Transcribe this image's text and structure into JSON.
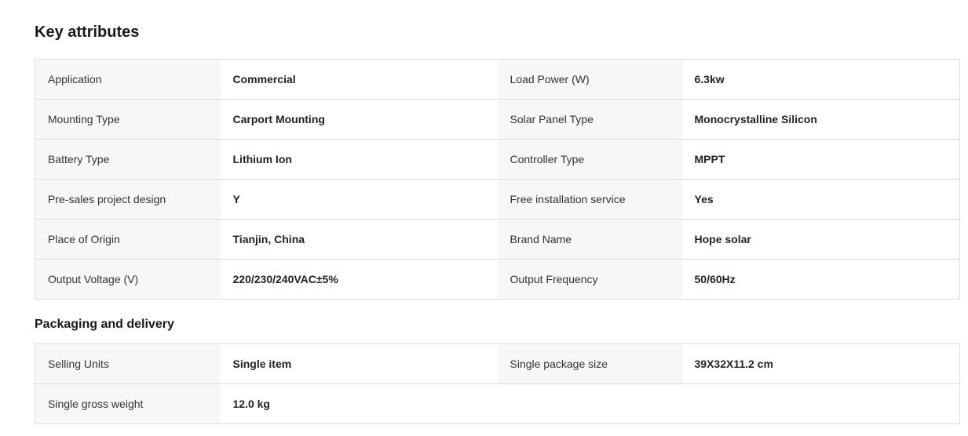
{
  "key_attributes": {
    "title": "Key attributes",
    "rows": [
      [
        {
          "label": "Application",
          "value": "Commercial"
        },
        {
          "label": "Load Power (W)",
          "value": "6.3kw"
        }
      ],
      [
        {
          "label": "Mounting Type",
          "value": "Carport Mounting"
        },
        {
          "label": "Solar Panel Type",
          "value": "Monocrystalline Silicon"
        }
      ],
      [
        {
          "label": "Battery Type",
          "value": "Lithium Ion"
        },
        {
          "label": "Controller Type",
          "value": "MPPT"
        }
      ],
      [
        {
          "label": "Pre-sales project design",
          "value": "Y"
        },
        {
          "label": "Free installation service",
          "value": "Yes"
        }
      ],
      [
        {
          "label": "Place of Origin",
          "value": "Tianjin, China"
        },
        {
          "label": "Brand Name",
          "value": "Hope solar"
        }
      ],
      [
        {
          "label": "Output Voltage (V)",
          "value": "220/230/240VAC±5%"
        },
        {
          "label": "Output Frequency",
          "value": "50/60Hz"
        }
      ]
    ]
  },
  "packaging": {
    "title": "Packaging and delivery",
    "rows": [
      [
        {
          "label": "Selling Units",
          "value": "Single item"
        },
        {
          "label": "Single package size",
          "value": "39X32X11.2 cm"
        }
      ],
      [
        {
          "label": "Single gross weight",
          "value": "12.0 kg"
        }
      ]
    ]
  }
}
